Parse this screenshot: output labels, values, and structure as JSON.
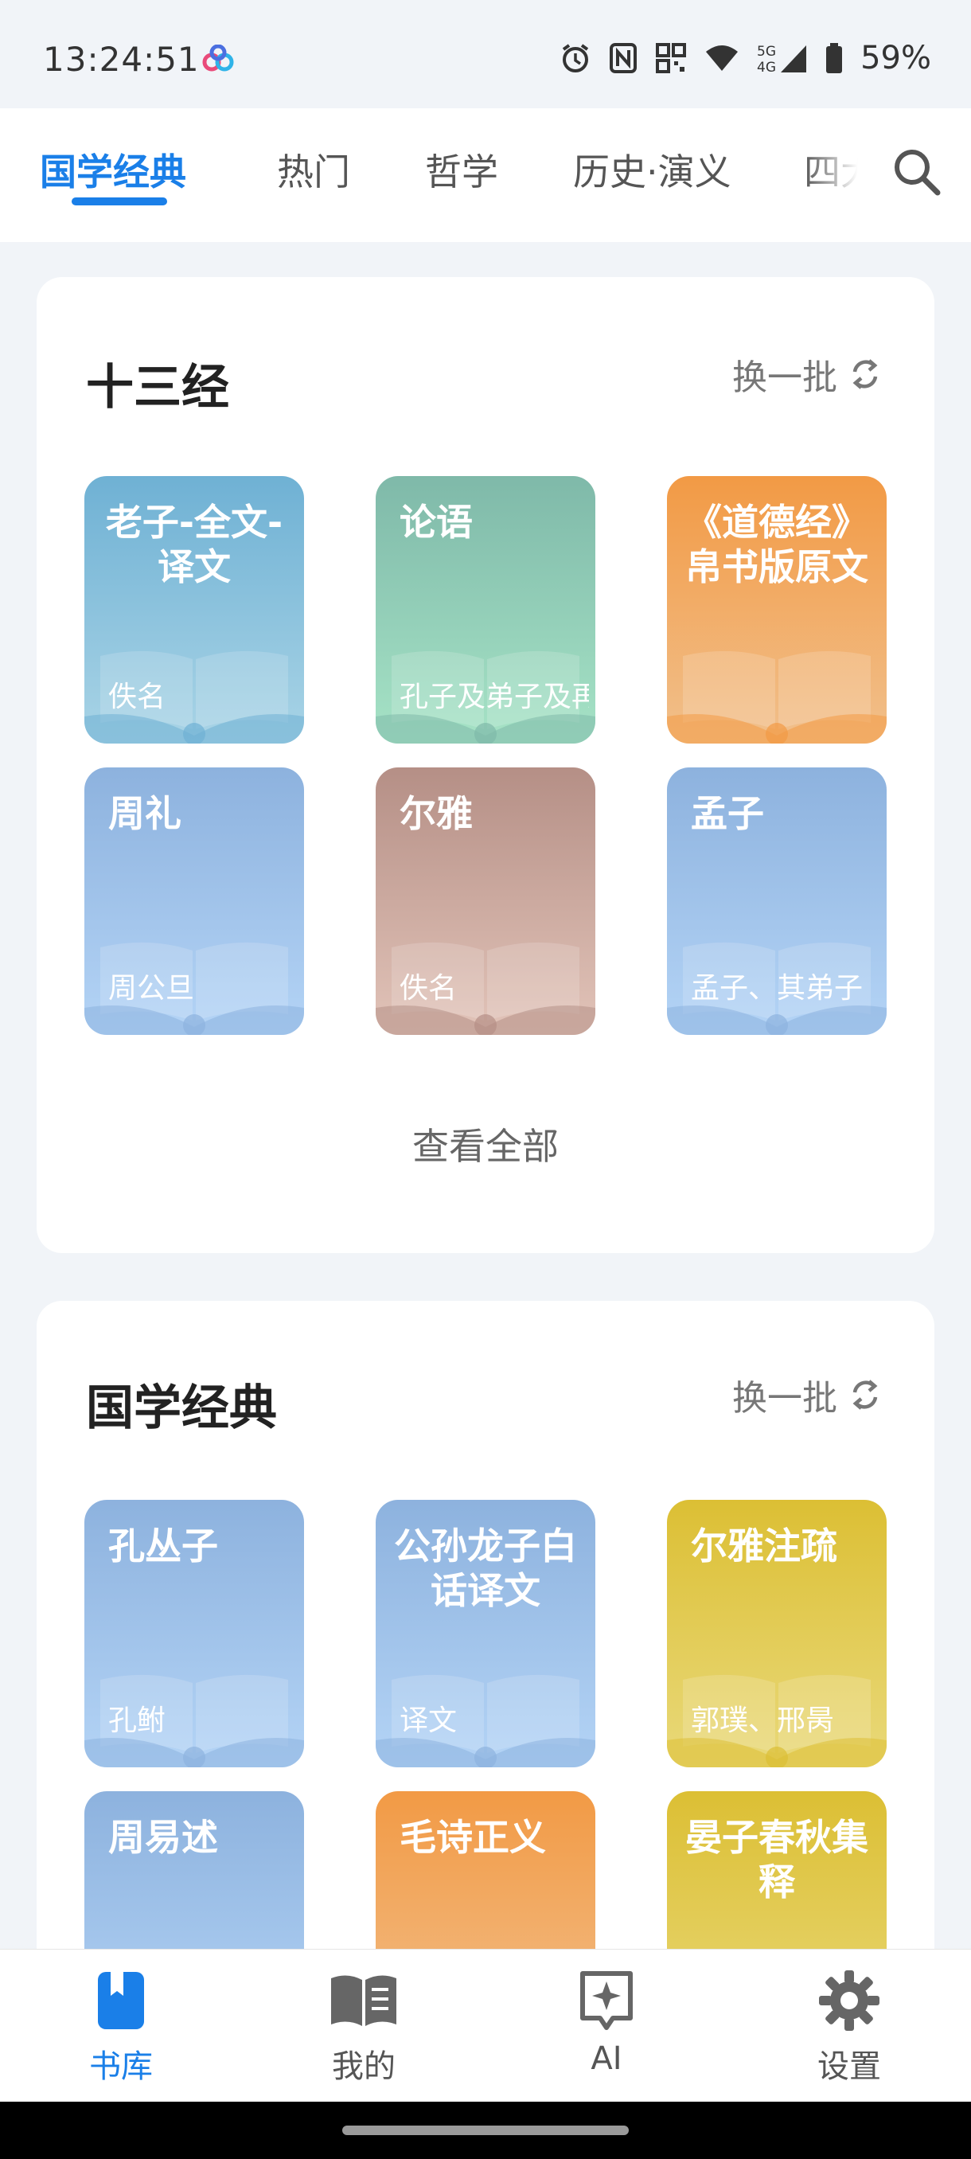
{
  "status": {
    "time": "13:24:51",
    "battery": "59%",
    "network": "5G 4G"
  },
  "tabs": [
    "国学经典",
    "热门",
    "哲学",
    "历史·演义",
    "四大"
  ],
  "sections": [
    {
      "title": "十三经",
      "refresh_label": "换一批",
      "view_all_label": "查看全部",
      "books": [
        {
          "title": "老子-全文-译文",
          "author": "佚名",
          "color_top": "#6fb1d4",
          "color_bottom": "#a9d4e6"
        },
        {
          "title": "论语",
          "author": "孔子及弟子及再传弟子",
          "color_top": "#7fb9a9",
          "color_bottom": "#a6e3c6"
        },
        {
          "title": "《道德经》帛书版原文",
          "author": "",
          "color_top": "#f29a45",
          "color_bottom": "#f1c08c"
        },
        {
          "title": "周礼",
          "author": "周公旦",
          "color_top": "#8db2de",
          "color_bottom": "#b4d4f6"
        },
        {
          "title": "尔雅",
          "author": "佚名",
          "color_top": "#b58f86",
          "color_bottom": "#e2c4b9"
        },
        {
          "title": "孟子",
          "author": "孟子、其弟子",
          "color_top": "#8db2de",
          "color_bottom": "#b4d4f6"
        }
      ]
    },
    {
      "title": "国学经典",
      "refresh_label": "换一批",
      "books": [
        {
          "title": "孔丛子",
          "author": "孔鲋",
          "color_top": "#8db2de",
          "color_bottom": "#b4d4f6"
        },
        {
          "title": "公孙龙子白话译文",
          "author": "译文",
          "color_top": "#8db2de",
          "color_bottom": "#b4d4f6"
        },
        {
          "title": "尔雅注疏",
          "author": "郭璞、邢昺",
          "color_top": "#dcbf34",
          "color_bottom": "#e9d97a"
        },
        {
          "title": "周易述",
          "author": "",
          "color_top": "#8db2de",
          "color_bottom": "#b4d4f6"
        },
        {
          "title": "毛诗正义",
          "author": "",
          "color_top": "#f29a45",
          "color_bottom": "#f1c08c"
        },
        {
          "title": "晏子春秋集释",
          "author": "",
          "color_top": "#dcbf34",
          "color_bottom": "#e9d97a"
        }
      ]
    }
  ],
  "bottom_nav": [
    {
      "label": "书库",
      "icon": "library-icon",
      "active": true
    },
    {
      "label": "我的",
      "icon": "open-book-icon",
      "active": false
    },
    {
      "label": "AI",
      "icon": "ai-sparkle-icon",
      "active": false
    },
    {
      "label": "设置",
      "icon": "gear-icon",
      "active": false
    }
  ],
  "colors": {
    "accent": "#1a7fe8",
    "background": "#f1f4f8"
  }
}
